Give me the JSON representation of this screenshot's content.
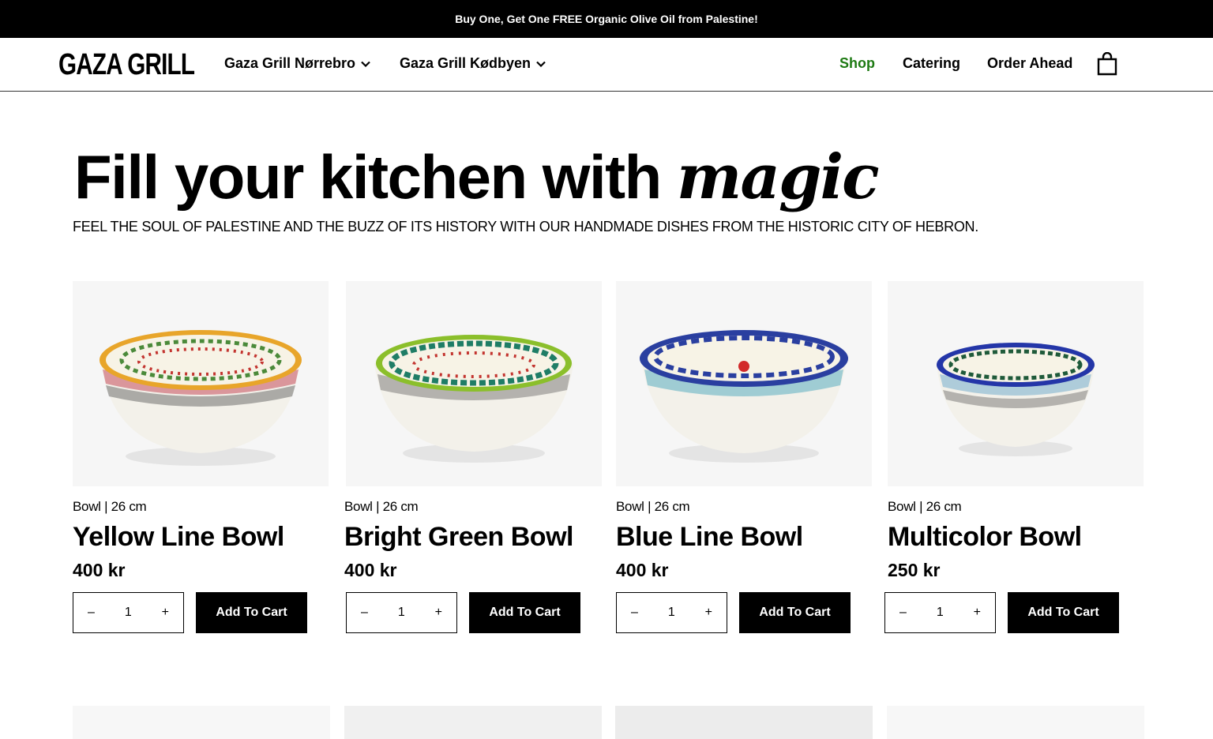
{
  "promo": {
    "text": "Buy One, Get One FREE Organic Olive Oil from Palestine!"
  },
  "header": {
    "logo": "GAZA GRILL",
    "locations": [
      "Gaza Grill Nørrebro",
      "Gaza Grill Kødbyen"
    ],
    "links": {
      "shop": "Shop",
      "catering": "Catering",
      "order": "Order Ahead"
    },
    "active_color": "#1e7a13"
  },
  "hero": {
    "title_plain": "Fill your kitchen with",
    "title_accent": "magic",
    "subtitle": "FEEL THE SOUL OF PALESTINE AND THE BUZZ OF ITS HISTORY WITH OUR HANDMADE DISHES FROM THE HISTORIC CITY OF HEBRON."
  },
  "products": [
    {
      "category": "Bowl | 26 cm",
      "name": "Yellow Line Bowl",
      "price": "400 kr",
      "qty": "1",
      "minus": "–",
      "plus": "+",
      "button": "Add To Cart",
      "rim_color": "#e8a52a"
    },
    {
      "category": "Bowl | 26 cm",
      "name": "Bright Green Bowl",
      "price": "400 kr",
      "qty": "1",
      "minus": "–",
      "plus": "+",
      "button": "Add To Cart",
      "rim_color": "#8bbf2b"
    },
    {
      "category": "Bowl | 26 cm",
      "name": "Blue Line Bowl",
      "price": "400 kr",
      "qty": "1",
      "minus": "–",
      "plus": "+",
      "button": "Add To Cart",
      "rim_color": "#2a3fa0"
    },
    {
      "category": "Bowl | 26 cm",
      "name": "Multicolor Bowl",
      "price": "250 kr",
      "qty": "1",
      "minus": "–",
      "plus": "+",
      "button": "Add To Cart",
      "rim_color": "#2436a8"
    }
  ]
}
